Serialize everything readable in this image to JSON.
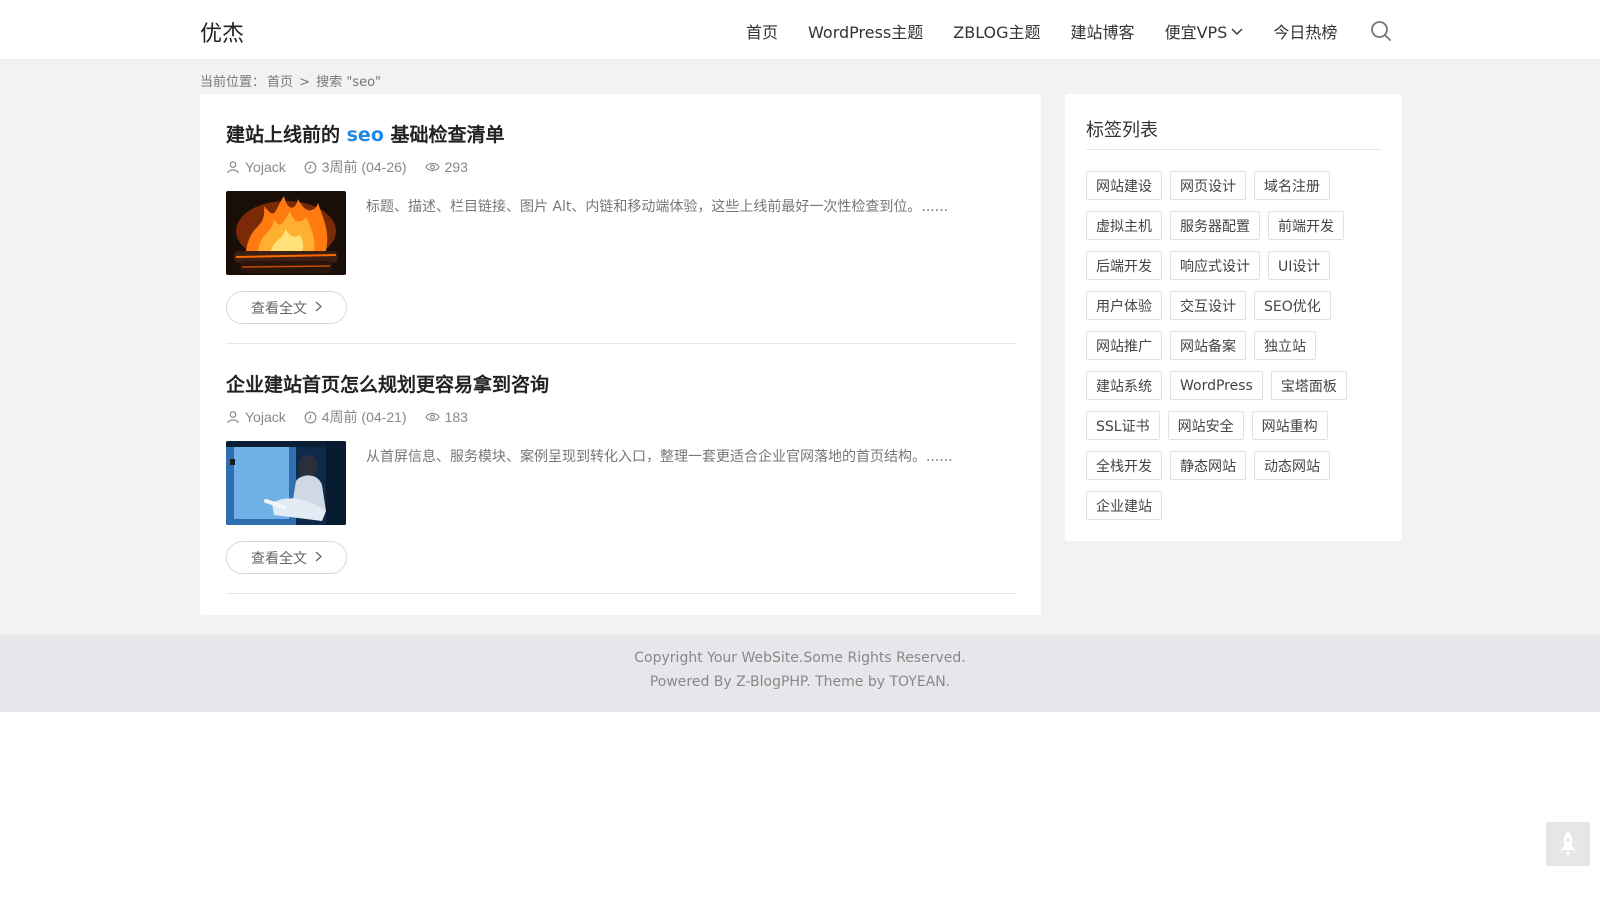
{
  "site": {
    "logo": "优杰"
  },
  "nav": {
    "items": [
      "首页",
      "WordPress主题",
      "ZBLOG主题",
      "建站博客",
      "便宜VPS",
      "今日热榜"
    ]
  },
  "breadcrumb": {
    "prefix": "当前位置：",
    "home": "首页",
    "sep": ">",
    "current": "搜索 \"seo\""
  },
  "posts": [
    {
      "title_before": "建站上线前的 ",
      "title_highlight": "seo",
      "title_after": " 基础检查清单",
      "author": "Yojack",
      "date": "3周前 (04-26)",
      "views": "293",
      "excerpt": "标题、描述、栏目链接、图片 Alt、内链和移动端体验，这些上线前最好一次性检查到位。......",
      "more": "查看全文",
      "thumb": "fire-photo"
    },
    {
      "title": "企业建站首页怎么规划更容易拿到咨询",
      "author": "Yojack",
      "date": "4周前 (04-21)",
      "views": "183",
      "excerpt": "从首屏信息、服务模块、案例呈现到转化入口，整理一套更适合企业官网落地的首页结构。......",
      "more": "查看全文",
      "thumb": "person-window-photo"
    }
  ],
  "sidebar": {
    "title": "标签列表",
    "tags": [
      "网站建设",
      "网页设计",
      "域名注册",
      "虚拟主机",
      "服务器配置",
      "前端开发",
      "后端开发",
      "响应式设计",
      "UI设计",
      "用户体验",
      "交互设计",
      "SEO优化",
      "网站推广",
      "网站备案",
      "独立站",
      "建站系统",
      "WordPress",
      "宝塔面板",
      "SSL证书",
      "网站安全",
      "网站重构",
      "全栈开发",
      "静态网站",
      "动态网站",
      "企业建站"
    ]
  },
  "footer": {
    "line1": "Copyright Your WebSite.Some Rights Reserved.",
    "line2": "Powered By Z-BlogPHP. Theme by TOYEAN."
  },
  "colors": {
    "highlight": "#1e88e5",
    "background": "#f2f2f2",
    "footer_bg": "#e6e7ea"
  },
  "icons": [
    "search-icon",
    "user-icon",
    "clock-icon",
    "eye-icon",
    "chevron-down-icon",
    "chevron-right-icon",
    "rocket-icon"
  ]
}
